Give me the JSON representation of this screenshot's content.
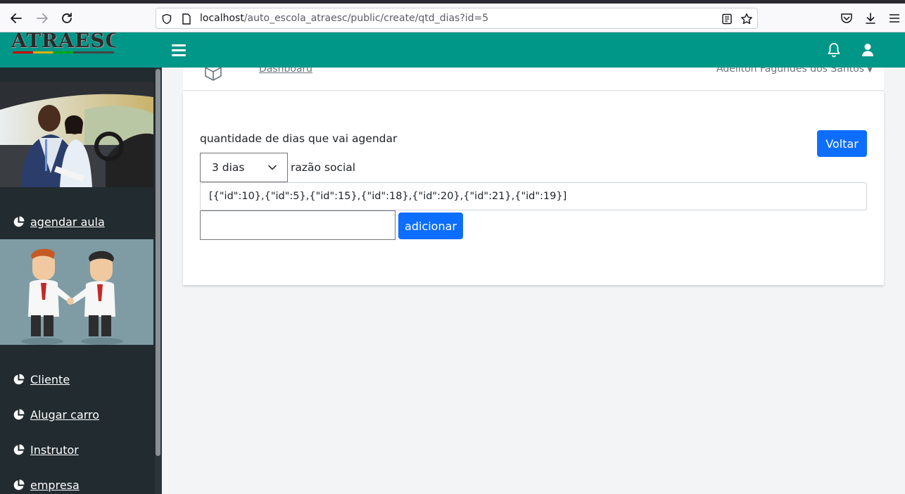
{
  "browser": {
    "url_host": "localhost",
    "url_path": "/auto_escola_atraesc/public/create/qtd_dias?id=5"
  },
  "app": {
    "logo_text": "ATRAESC"
  },
  "sidebar": {
    "items": [
      {
        "label": "agendar aula"
      },
      {
        "label": "Cliente"
      },
      {
        "label": "Alugar carro"
      },
      {
        "label": "Instrutor"
      },
      {
        "label": "empresa"
      }
    ]
  },
  "topbar": {
    "dashboard_label": "Dashboard",
    "user_name": "Adeilton Fagundes dos Santos"
  },
  "form": {
    "days_label": "quantidade de dias que vai agendar",
    "back_button": "Voltar",
    "days_select_value": "3 dias",
    "company_label": "razão social",
    "json_value": "[{\"id\":10},{\"id\":5},{\"id\":15},{\"id\":18},{\"id\":20},{\"id\":21},{\"id\":19}]",
    "text_input_value": "",
    "add_button": "adicionar"
  },
  "colors": {
    "header": "#009688",
    "sidebar": "#212b30",
    "primary_button": "#0d6efd"
  }
}
